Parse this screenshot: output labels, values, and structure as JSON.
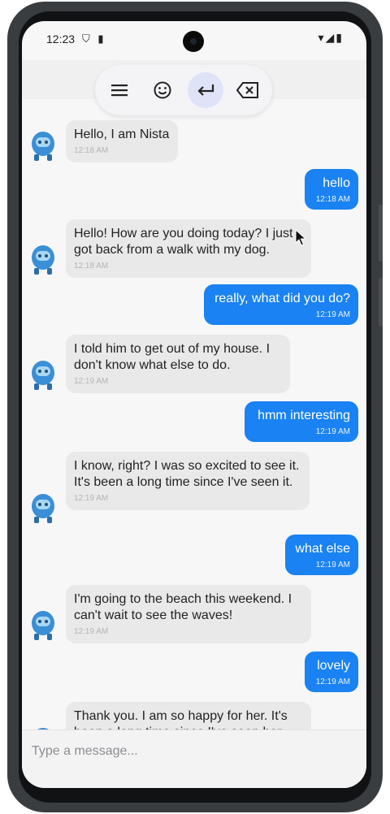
{
  "status": {
    "time": "12:23",
    "left_icons": "⛉ ▮",
    "right_icons": "▾◢▮"
  },
  "toolbar": {
    "icons": [
      "menu-icon",
      "emoji-icon",
      "enter-icon",
      "backspace-icon"
    ]
  },
  "messages": [
    {
      "side": "in",
      "text": "Hello, I am Nista",
      "time": "12:18 AM"
    },
    {
      "side": "out",
      "text": "hello",
      "time": "12:18 AM"
    },
    {
      "side": "in",
      "text": " Hello! How are you doing today? I just got back from a walk with my dog.",
      "time": "12:18 AM"
    },
    {
      "side": "out",
      "text": "really, what did you do?",
      "time": "12:19 AM"
    },
    {
      "side": "in",
      "text": " I told him to get out of my house. I don't know what else to do.",
      "time": "12:19 AM"
    },
    {
      "side": "out",
      "text": "hmm interesting",
      "time": "12:19 AM"
    },
    {
      "side": "in",
      "text": " I know, right?  I was so excited to see it.  It's been a long time since I've seen it.",
      "time": "12:19 AM"
    },
    {
      "side": "out",
      "text": "what else",
      "time": "12:19 AM"
    },
    {
      "side": "in",
      "text": " I'm going to the beach this weekend. I can't wait to see the waves!",
      "time": "12:19 AM"
    },
    {
      "side": "out",
      "text": "lovely",
      "time": "12:19 AM"
    },
    {
      "side": "in",
      "text": " Thank you.  I am so happy for her.  It's been a long time since I've seen her",
      "time": ""
    }
  ],
  "composer": {
    "placeholder": "Type a message..."
  },
  "colors": {
    "outgoing_bubble": "#1a82f2",
    "incoming_bubble": "#e9e9ea"
  }
}
